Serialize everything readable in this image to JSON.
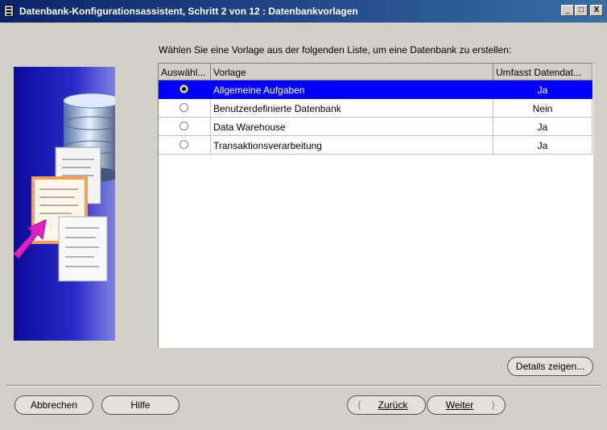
{
  "window": {
    "title": "Datenbank-Konfigurationsassistent, Schritt 2 von 12 : Datenbankvorlagen",
    "minimize": "_",
    "maximize": "□",
    "close": "X"
  },
  "prompt": "Wählen Sie eine Vorlage aus der folgenden Liste, um eine Datenbank zu erstellen:",
  "table": {
    "columns": [
      "Auswähl...",
      "Vorlage",
      "Umfasst Datendat..."
    ],
    "rows": [
      {
        "selected": true,
        "template": "Allgemeine Aufgaben",
        "includes": "Ja"
      },
      {
        "selected": false,
        "template": "Benutzerdefinierte Datenbank",
        "includes": "Nein"
      },
      {
        "selected": false,
        "template": "Data Warehouse",
        "includes": "Ja"
      },
      {
        "selected": false,
        "template": "Transaktionsverarbeitung",
        "includes": "Ja"
      }
    ]
  },
  "buttons": {
    "details": "Details zeigen...",
    "cancel": "Abbrechen",
    "help": "Hilfe",
    "back": "Zurück",
    "next": "Weiter"
  },
  "colors": {
    "title_bar": "#0a246a",
    "selection": "#0000ff",
    "illustration_bg": "#1a1aa8",
    "arrow": "#e020c0"
  }
}
